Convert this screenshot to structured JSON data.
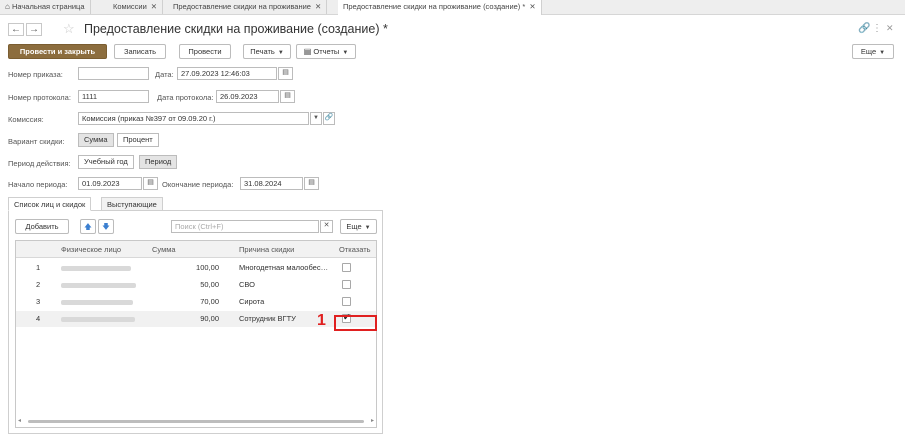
{
  "tabs": [
    {
      "label": "Начальная страница",
      "home": true
    },
    {
      "label": "Комиссии",
      "closable": true
    },
    {
      "label": "Предоставление скидки на проживание",
      "closable": true
    },
    {
      "label": "Предоставление скидки на проживание (создание) *",
      "closable": true,
      "active": true
    }
  ],
  "window": {
    "title": "Предоставление скидки на проживание (создание) *",
    "link_icon": "link-icon",
    "more_icon": "more-vertical-icon",
    "close_icon": "close-icon"
  },
  "toolbar": {
    "post_close": "Провести и закрыть",
    "save": "Записать",
    "post": "Провести",
    "print": "Печать",
    "reports": "Отчеты",
    "more": "Еще"
  },
  "form": {
    "order_no_label": "Номер приказа:",
    "order_no_value": "",
    "date_label": "Дата:",
    "date_value": "27.09.2023 12:46:03",
    "protocol_no_label": "Номер протокола:",
    "protocol_no_value": "1111",
    "protocol_date_label": "Дата протокола:",
    "protocol_date_value": "26.09.2023",
    "commission_label": "Комиссия:",
    "commission_value": "Комиссия (приказ №397 от 09.09.20 г.)",
    "discount_variant_label": "Вариант скидки:",
    "discount_variant_options": [
      "Сумма",
      "Процент"
    ],
    "discount_variant_selected": "Сумма",
    "period_label": "Период действия:",
    "period_options": [
      "Учебный год",
      "Период"
    ],
    "period_selected": "Период",
    "start_label": "Начало периода:",
    "start_value": "01.09.2023",
    "end_label": "Окончание периода:",
    "end_value": "31.08.2024"
  },
  "inner_tabs": [
    "Список лиц и скидок",
    "Выступающие"
  ],
  "list": {
    "add_label": "Добавить",
    "search_placeholder": "Поиск (Ctrl+F)",
    "more_label": "Еще",
    "columns": [
      "Физическое лицо",
      "Сумма",
      "Причина скидки",
      "Отказать"
    ],
    "rows": [
      {
        "n": "1",
        "amount": "100,00",
        "reason": "Многодетная малообеспеченная",
        "refuse": false
      },
      {
        "n": "2",
        "amount": "50,00",
        "reason": "СВО",
        "refuse": false
      },
      {
        "n": "3",
        "amount": "70,00",
        "reason": "Сирота",
        "refuse": false
      },
      {
        "n": "4",
        "amount": "90,00",
        "reason": "Сотрудник ВГТУ",
        "refuse": true
      }
    ]
  },
  "annotation": {
    "label": "1",
    "color": "#e02020"
  },
  "colors": {
    "primary": "#8c6d3e",
    "highlight": "#e02020"
  }
}
